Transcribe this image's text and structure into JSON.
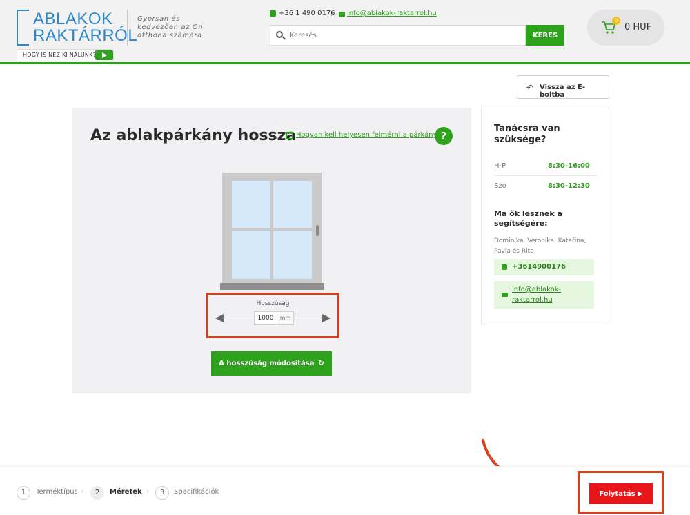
{
  "header": {
    "logo_line1": "ABLAKOK",
    "logo_line2": "RAKTÁRRÓL",
    "tagline": "Gyorsan és kedvezően az Ön otthona számára",
    "video_label": "HOGY IS NÉZ KI NÁLUNK?",
    "phone": "+36 1 490 0176",
    "separator": "/",
    "email": "info@ablakok-raktarrol.hu",
    "search_placeholder": "Keresés",
    "search_button": "KERES",
    "cart_count": "0",
    "cart_total": "0 HUF"
  },
  "back_button": "Vissza az E-boltba",
  "main": {
    "title": "Az ablakpárkány hossza",
    "measure_link": "Hogyan kell helyesen felmérni a párkányt",
    "help": "?",
    "dimension_label": "Hosszúság",
    "dimension_value": "1000",
    "dimension_unit": "mm",
    "modify_button": "A hosszúság módosítása",
    "modify_icon": "↻"
  },
  "sidebar": {
    "title": "Tanácsra van szüksége?",
    "hours": [
      {
        "day": "H-P",
        "time": "8:30-16:00"
      },
      {
        "day": "Szo",
        "time": "8:30-12:30"
      }
    ],
    "subtitle": "Ma ők lesznek a segítségére:",
    "names": "Dominika, Veronika, Kateřina, Pavla és Rita",
    "phone": "+3614900176",
    "email": "info@ablakok-raktarrol.hu"
  },
  "steps": [
    {
      "num": "1",
      "label": "Terméktípus"
    },
    {
      "num": "2",
      "label": "Méretek"
    },
    {
      "num": "3",
      "label": "Specifikációk"
    }
  ],
  "step_chevron": "›",
  "continue_button": "Folytatás ▶",
  "colors": {
    "brand_green": "#2ea11d",
    "logo_blue": "#2f86c6",
    "highlight_red": "#d5411c",
    "continue_red": "#e8151b"
  }
}
